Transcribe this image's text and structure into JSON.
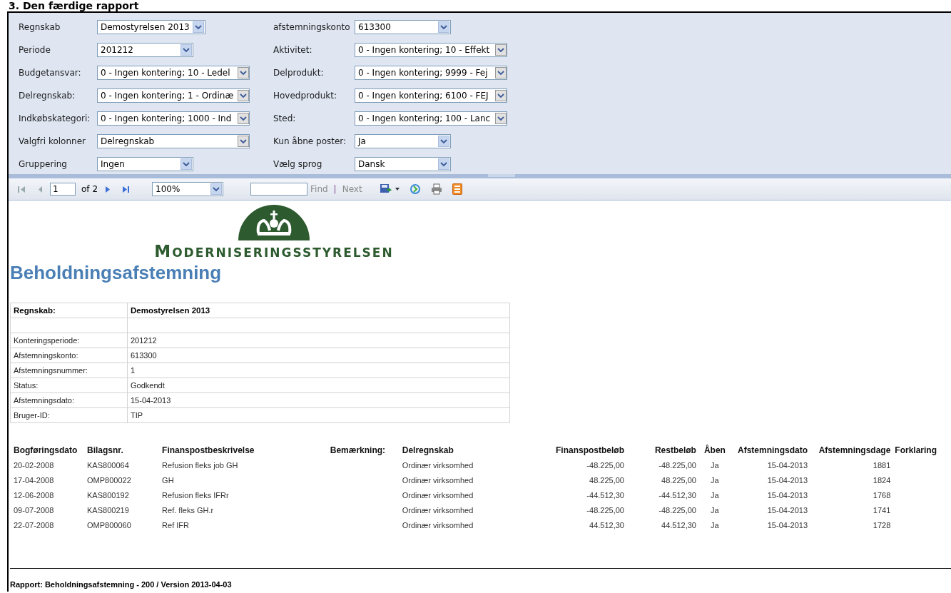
{
  "page_heading": "3. Den færdige rapport",
  "parameters": {
    "left": [
      {
        "label": "Regnskab",
        "value": "Demostyrelsen 2013",
        "kind": "compact"
      },
      {
        "label": "Periode",
        "value": "201212",
        "kind": "short"
      },
      {
        "label": "Budgetansvar:",
        "value": "0 - Ingen kontering; 10 - Ledel",
        "kind": "split"
      },
      {
        "label": "Delregnskab:",
        "value": "0 - Ingen kontering; 1 - Ordinæ",
        "kind": "split"
      },
      {
        "label": "Indkøbskategori:",
        "value": "0 - Ingen kontering; 1000 - Ind",
        "kind": "split"
      },
      {
        "label": "Valgfri kolonner",
        "value": "Delregnskab",
        "kind": "split"
      },
      {
        "label": "Gruppering",
        "value": "Ingen",
        "kind": "short"
      }
    ],
    "right": [
      {
        "label": "afstemningskonto",
        "value": "613300",
        "kind": "short"
      },
      {
        "label": "Aktivitet:",
        "value": "0 - Ingen kontering; 10 - Effekt",
        "kind": "split"
      },
      {
        "label": "Delprodukt:",
        "value": "0 - Ingen kontering; 9999 - Fej",
        "kind": "split"
      },
      {
        "label": "Hovedprodukt:",
        "value": "0 - Ingen kontering; 6100 - FEJ",
        "kind": "split"
      },
      {
        "label": "Sted:",
        "value": "0 - Ingen kontering; 100 - Lanc",
        "kind": "split"
      },
      {
        "label": "Kun åbne poster:",
        "value": "Ja",
        "kind": "short"
      },
      {
        "label": "Vælg sprog",
        "value": "Dansk",
        "kind": "short"
      }
    ]
  },
  "toolbar": {
    "page": "1",
    "page_count": "of 2",
    "zoom": "100%",
    "find": "Find",
    "separator": "|",
    "next": "Next"
  },
  "report": {
    "logo_text": "MODERNISERINGSSTYRELSEN",
    "title": "Beholdningsafstemning",
    "info": [
      {
        "label": "Regnskab:",
        "value": "Demostyrelsen 2013",
        "kind": "header"
      },
      {
        "kind": "blank"
      },
      {
        "label": "Konteringsperiode:",
        "value": "201212",
        "kind": "row"
      },
      {
        "label": "Afstemningskonto:",
        "value": "613300",
        "kind": "row"
      },
      {
        "label": "Afstemningsnummer:",
        "value": "1",
        "kind": "row"
      },
      {
        "label": "Status:",
        "value": "Godkendt",
        "kind": "row"
      },
      {
        "label": "Afstemningsdato:",
        "value": "15-04-2013",
        "kind": "row"
      },
      {
        "label": "Bruger-ID:",
        "value": "TIP",
        "kind": "row"
      }
    ],
    "table": {
      "columns": [
        "Bogføringsdato",
        "Bilagsnr.",
        "Finanspostbeskrivelse",
        "Bemærkning:",
        "Delregnskab",
        "Finanspostbeløb",
        "Restbeløb",
        "Åben",
        "Afstemningsdato",
        "Afstemningsdage",
        "Forklaring"
      ],
      "rows": [
        {
          "date": "20-02-2008",
          "voucher": "KAS800064",
          "description": "Refusion fleks job GH",
          "subledger": "Ordinær virksomhed",
          "amount": "-48.225,00",
          "remaining": "-48.225,00",
          "open": "Ja",
          "reconciliation_date": "15-04-2013",
          "days": "1881"
        },
        {
          "date": "17-04-2008",
          "voucher": "OMP800022",
          "description": "GH",
          "subledger": "Ordinær virksomhed",
          "amount": "48.225,00",
          "remaining": "48.225,00",
          "open": "Ja",
          "reconciliation_date": "15-04-2013",
          "days": "1824"
        },
        {
          "date": "12-06-2008",
          "voucher": "KAS800192",
          "description": "Refusion fleks IFRr",
          "subledger": "Ordinær virksomhed",
          "amount": "-44.512,30",
          "remaining": "-44.512,30",
          "open": "Ja",
          "reconciliation_date": "15-04-2013",
          "days": "1768"
        },
        {
          "date": "09-07-2008",
          "voucher": "KAS800219",
          "description": "Ref. fleks GH.r",
          "subledger": "Ordinær virksomhed",
          "amount": "-48.225,00",
          "remaining": "-48.225,00",
          "open": "Ja",
          "reconciliation_date": "15-04-2013",
          "days": "1741"
        },
        {
          "date": "22-07-2008",
          "voucher": "OMP800060",
          "description": "Ref IFR",
          "subledger": "Ordinær virksomhed",
          "amount": "44.512,30",
          "remaining": "44.512,30",
          "open": "Ja",
          "reconciliation_date": "15-04-2013",
          "days": "1728"
        }
      ]
    },
    "footer": "Rapport: Beholdningsafstemning - 200 / Version 2013-04-03"
  }
}
